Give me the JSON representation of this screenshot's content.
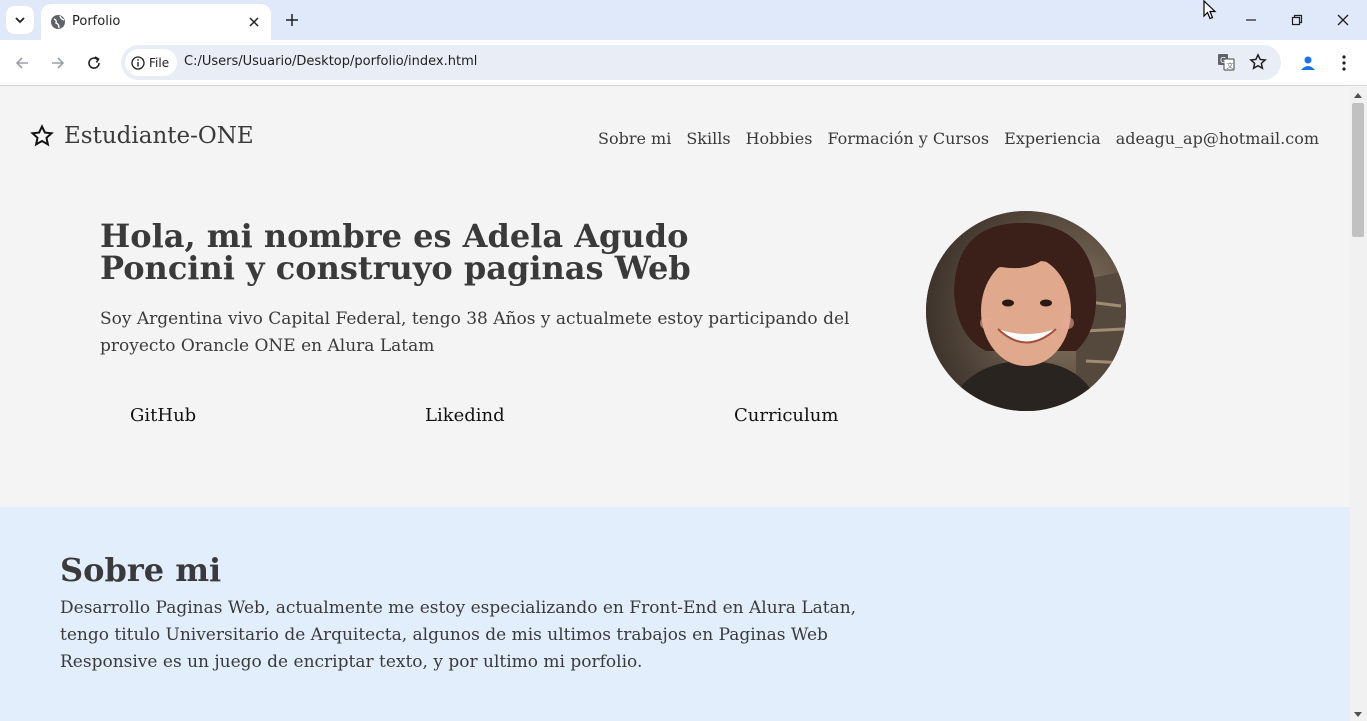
{
  "browser": {
    "tab_title": "Porfolio",
    "site_chip": "File",
    "url": "C:/Users/Usuario/Desktop/porfolio/index.html"
  },
  "page": {
    "brand": "Estudiante-ONE",
    "nav": [
      "Sobre mi",
      "Skills",
      "Hobbies",
      "Formación y Cursos",
      "Experiencia",
      "adeagu_ap@hotmail.com"
    ],
    "hero": {
      "title": "Hola, mi nombre es Adela Agudo Poncini y construyo paginas Web",
      "text": "Soy Argentina vivo Capital Federal, tengo 38 Años y actualmete estoy participando del proyecto Orancle ONE en Alura Latam",
      "links": [
        "GitHub",
        "Likedind",
        "Curriculum"
      ]
    },
    "about": {
      "heading": "Sobre mi",
      "text": "Desarrollo Paginas Web, actualmente me estoy especializando en Front-End en Alura Latan, tengo titulo Universitario de Arquitecta, algunos de mis ultimos trabajos en Paginas Web Responsive es un juego de encriptar texto, y por ultimo mi porfolio."
    }
  },
  "colors": {
    "chrome_bg": "#dfe9f9",
    "page_bg": "#f4f4f4",
    "about_bg": "#e3eefd",
    "text": "#3a3a3a"
  }
}
